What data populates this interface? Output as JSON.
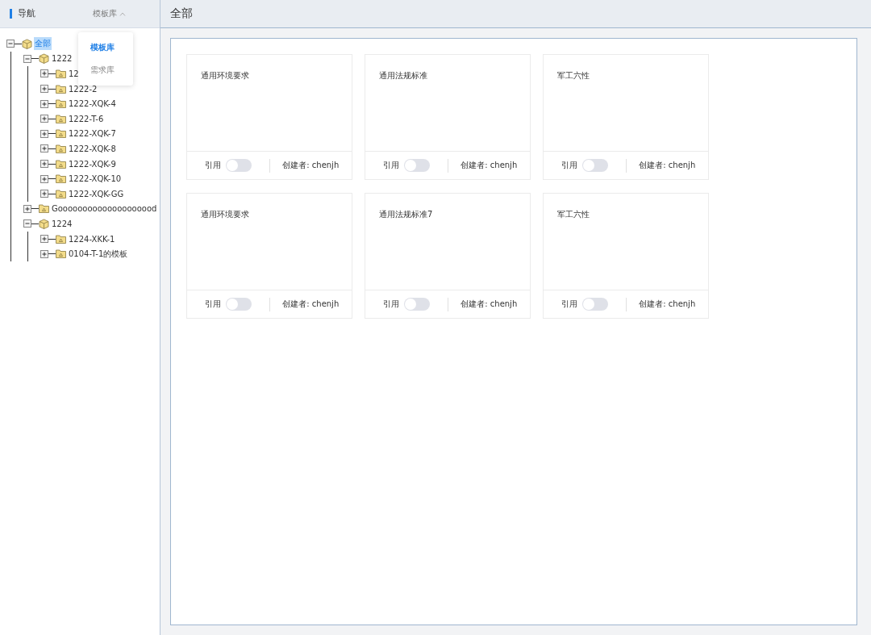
{
  "sidebar": {
    "title": "导航",
    "library_select": {
      "label": "模板库",
      "expanded": true,
      "options": [
        {
          "label": "模板库",
          "selected": true
        },
        {
          "label": "需求库",
          "selected": false
        }
      ]
    },
    "tree": [
      {
        "label": "全部",
        "kind": "cube",
        "expanded": true,
        "selected": true,
        "children": [
          {
            "label": "1222",
            "kind": "cube",
            "expanded": true,
            "selected": false,
            "children": [
              {
                "label": "12",
                "kind": "folder",
                "expanded": false,
                "selected": false
              },
              {
                "label": "1222-2",
                "kind": "folder",
                "expanded": false,
                "selected": false
              },
              {
                "label": "1222-XQK-4",
                "kind": "folder",
                "expanded": false,
                "selected": false
              },
              {
                "label": "1222-T-6",
                "kind": "folder",
                "expanded": false,
                "selected": false
              },
              {
                "label": "1222-XQK-7",
                "kind": "folder",
                "expanded": false,
                "selected": false
              },
              {
                "label": "1222-XQK-8",
                "kind": "folder",
                "expanded": false,
                "selected": false
              },
              {
                "label": "1222-XQK-9",
                "kind": "folder",
                "expanded": false,
                "selected": false
              },
              {
                "label": "1222-XQK-10",
                "kind": "folder",
                "expanded": false,
                "selected": false
              },
              {
                "label": "1222-XQK-GG",
                "kind": "folder",
                "expanded": false,
                "selected": false
              }
            ]
          },
          {
            "label": "Goooooooooooooooooood",
            "kind": "folder",
            "expanded": false,
            "selected": false
          },
          {
            "label": "1224",
            "kind": "cube",
            "expanded": true,
            "selected": false,
            "children": [
              {
                "label": "1224-XKK-1",
                "kind": "folder",
                "expanded": false,
                "selected": false
              },
              {
                "label": "0104-T-1的模板",
                "kind": "folder",
                "expanded": false,
                "selected": false
              }
            ]
          }
        ]
      }
    ]
  },
  "main": {
    "title": "全部",
    "cards": [
      {
        "title": "通用环境要求",
        "cite_label": "引用",
        "cited": false,
        "creator": "创建者: chenjh"
      },
      {
        "title": "通用法规标准",
        "cite_label": "引用",
        "cited": false,
        "creator": "创建者: chenjh"
      },
      {
        "title": "军工六性",
        "cite_label": "引用",
        "cited": false,
        "creator": "创建者: chenjh"
      },
      {
        "title": "通用环境要求",
        "cite_label": "引用",
        "cited": false,
        "creator": "创建者: chenjh"
      },
      {
        "title": "通用法规标准7",
        "cite_label": "引用",
        "cited": false,
        "creator": "创建者: chenjh"
      },
      {
        "title": "军工六性",
        "cite_label": "引用",
        "cited": false,
        "creator": "创建者: chenjh"
      }
    ]
  }
}
